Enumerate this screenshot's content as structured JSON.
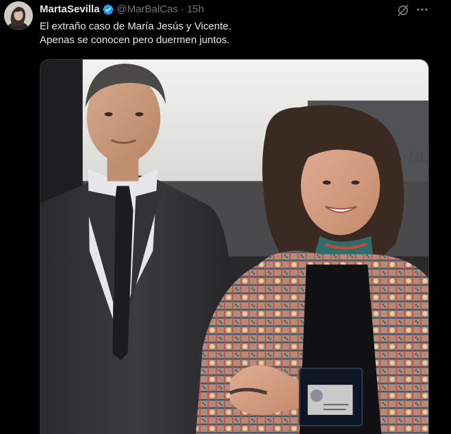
{
  "tweet": {
    "display_name": "MartaSevilla",
    "verified": true,
    "handle": "@MarBalCas",
    "separator": "·",
    "timestamp": "15h",
    "text_lines": [
      "El extraño caso de María Jesús y Vicente.",
      "Apenas se conocen pero duermen juntos."
    ],
    "media": {
      "type": "photo",
      "background_sign_text": "NÓ"
    }
  },
  "icons": {
    "verified": "verified-badge-icon",
    "grok": "grok-icon",
    "more": "more-options-icon"
  },
  "colors": {
    "background": "#000000",
    "primary_text": "#e7e9ea",
    "secondary_text": "#71767b",
    "verified_blue": "#1d9bf0",
    "border": "#2f3336"
  }
}
